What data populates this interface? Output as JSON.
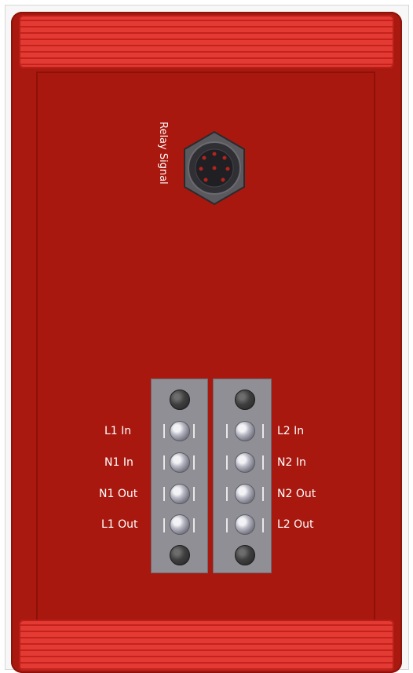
{
  "relay": {
    "label": "Relay Signal"
  },
  "terminals": {
    "left": [
      "L1 In",
      "N1 In",
      "N1 Out",
      "L1 Out"
    ],
    "right": [
      "L2 In",
      "N2 In",
      "N2 Out",
      "L2 Out"
    ]
  },
  "colors": {
    "body": "#a9190f",
    "cap": "#e43a34",
    "terminal": "#8f8f95",
    "screw": "#c9c9d4"
  }
}
